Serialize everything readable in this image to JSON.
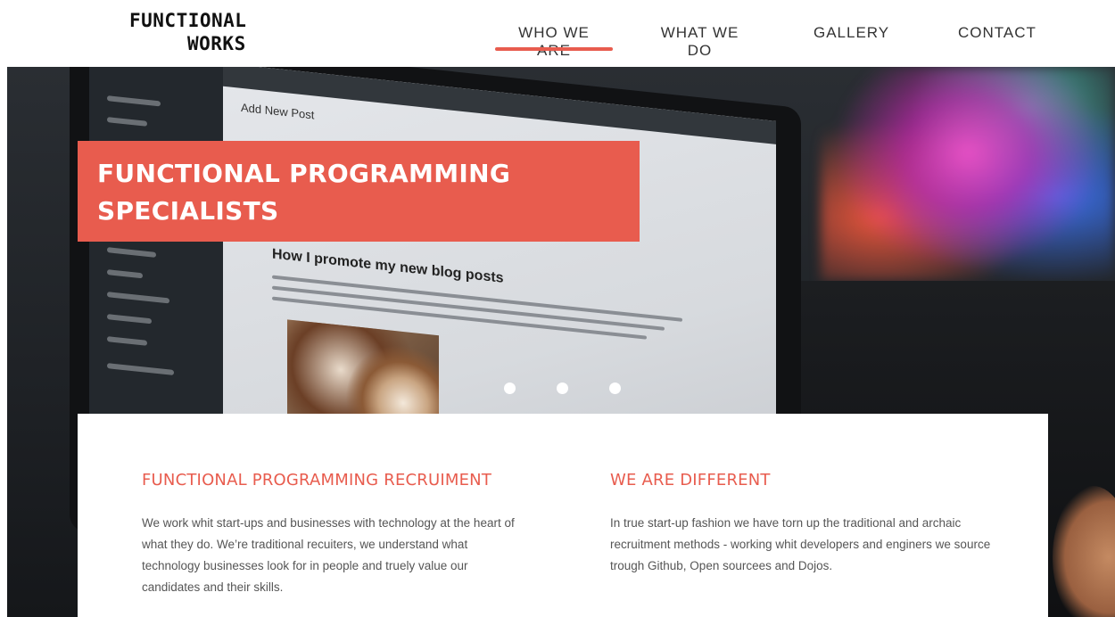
{
  "logo": {
    "line1": "FUNCTIONAL",
    "line2": "WORKS"
  },
  "nav": {
    "items": [
      {
        "label": "WHO WE ARE",
        "active": true
      },
      {
        "label": "WHAT WE DO",
        "active": false
      },
      {
        "label": "GALLERY",
        "active": false
      },
      {
        "label": "CONTACT",
        "active": false
      }
    ]
  },
  "hero": {
    "title": "FUNCTIONAL PROGRAMMING SPECIALISTS",
    "slides": 3,
    "screen": {
      "post_label": "Add New Post",
      "blog_title": "How I promote my new blog posts"
    }
  },
  "sections": [
    {
      "heading": "FUNCTIONAL PROGRAMMING RECRUIMENT",
      "body": "We work whit start-ups and businesses with technology at the heart of what they do. We’re traditional recuiters, we understand what technology businesses look for in people and truely value our candidates and their skills."
    },
    {
      "heading": "WE ARE DIFFERENT",
      "body": "In true start-up fashion we have torn up the traditional and archaic recruitment methods - working whit developers and enginers we source trough Github, Open sourcees and Dojos."
    }
  ],
  "colors": {
    "accent": "#e85c4e",
    "text": "#555555",
    "nav_text": "#333333"
  }
}
